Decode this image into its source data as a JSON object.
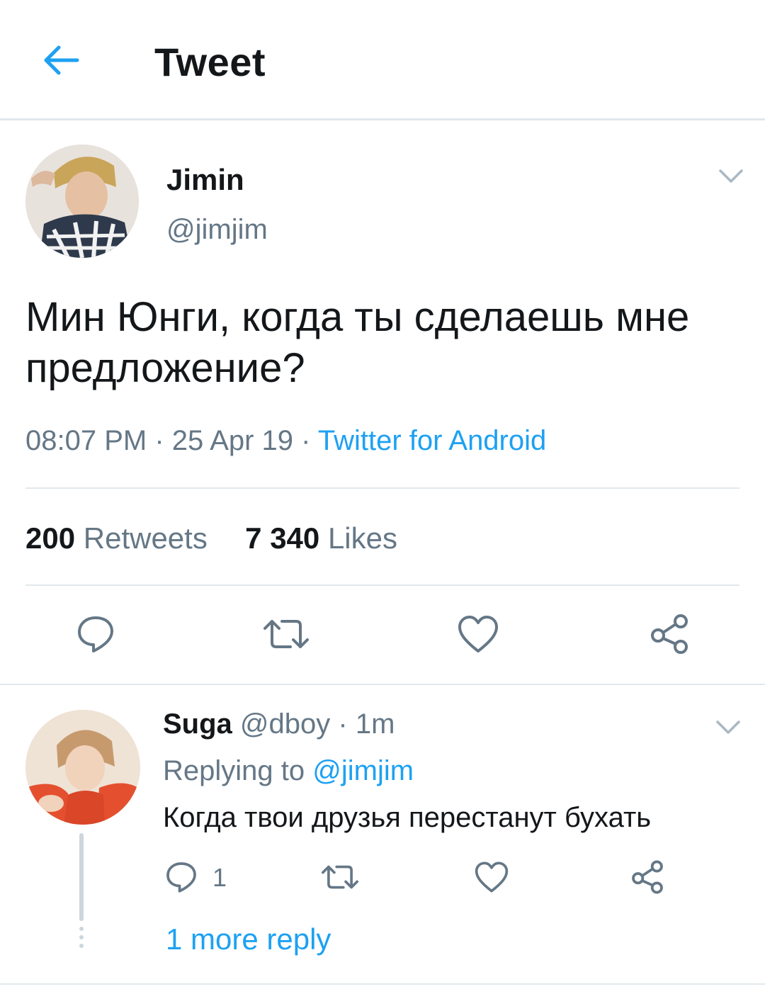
{
  "header": {
    "title": "Tweet",
    "back_icon": "arrow-left-icon"
  },
  "colors": {
    "accent": "#1da1f2",
    "secondary_text": "#657786",
    "divider": "#e1e8ed"
  },
  "tweet": {
    "author_name": "Jimin",
    "author_handle": "@jimjim",
    "text": "Мин Юнги, когда ты сделаешь мне предложение?",
    "time": "08:07 PM",
    "date": "25 Apr 19",
    "separator": "·",
    "source": "Twitter for Android",
    "retweets_count": "200",
    "retweets_label": "Retweets",
    "likes_count": "7 340",
    "likes_label": "Likes",
    "actions": [
      "reply-icon",
      "retweet-icon",
      "like-icon",
      "share-icon"
    ]
  },
  "reply": {
    "author_name": "Suga",
    "author_handle": "@dboy",
    "separator": "·",
    "time": "1m",
    "replying_prefix": "Replying to",
    "replying_to": "@jimjim",
    "text": "Когда твои друзья перестанут бухать",
    "reply_count": "1",
    "actions": [
      "reply-icon",
      "retweet-icon",
      "like-icon",
      "share-icon"
    ]
  },
  "thread": {
    "more_replies": "1 more reply"
  }
}
